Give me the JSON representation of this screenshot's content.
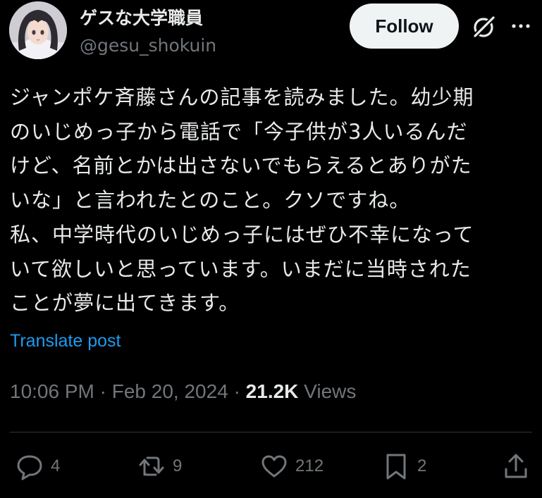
{
  "author": {
    "display_name": "ゲスな大学職員",
    "handle": "@gesu_shokuin"
  },
  "header": {
    "follow_label": "Follow"
  },
  "post": {
    "text": "ジャンポケ斉藤さんの記事を読みました。幼少期\nのいじめっ子から電話で「今子供が3人いるんだ\nけど、名前とかは出さないでもらえるとありがた\nいな」と言われたとのこと。クソですね。\n私、中学時代のいじめっ子にはぜひ不幸になって\nいて欲しいと思っています。いまだに当時された\nことが夢に出てきます。",
    "translate_label": "Translate post",
    "time": "10:06 PM",
    "separator": "·",
    "date": "Feb 20, 2024",
    "views_count": "21.2K",
    "views_label": "Views"
  },
  "actions": {
    "replies": "4",
    "reposts": "9",
    "likes": "212",
    "bookmarks": "2"
  },
  "icons": {
    "grok": "grok-icon",
    "more": "more-icon",
    "reply": "reply-icon",
    "repost": "repost-icon",
    "like": "heart-icon",
    "bookmark": "bookmark-icon",
    "share": "share-icon"
  },
  "colors": {
    "background": "#000000",
    "text": "#e7e9ea",
    "secondary_text": "#71767b",
    "link": "#1d9bf0",
    "follow_button_bg": "#eff3f4",
    "divider": "#2f3336"
  }
}
